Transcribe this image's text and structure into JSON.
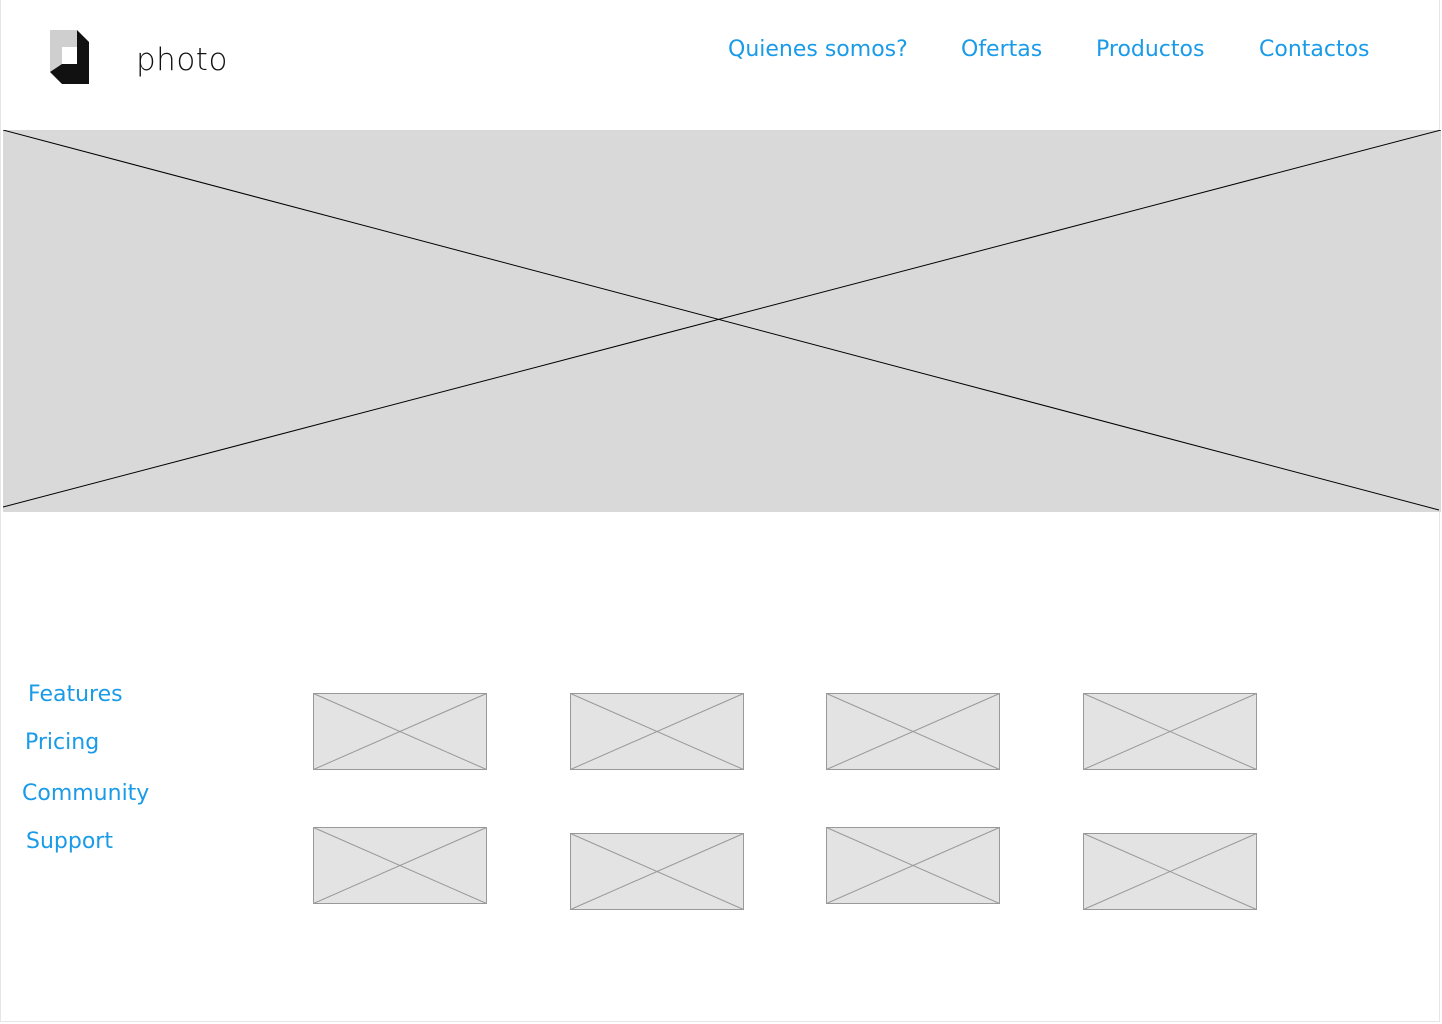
{
  "header": {
    "brand_name": "photo",
    "logo_icon": "photo-logo-icon",
    "nav": [
      {
        "label": "Quienes somos?"
      },
      {
        "label": "Ofertas"
      },
      {
        "label": "Productos"
      },
      {
        "label": "Contactos"
      }
    ]
  },
  "hero": {
    "icon": "image-placeholder-icon"
  },
  "sidebar": {
    "links": [
      {
        "label": "Features"
      },
      {
        "label": "Pricing"
      },
      {
        "label": "Community"
      },
      {
        "label": "Support"
      }
    ]
  },
  "gallery": {
    "thumb_icon": "image-placeholder-icon",
    "count": 8
  },
  "colors": {
    "link": "#1a9be8",
    "placeholder_fill": "#d9d9d9",
    "thumb_fill": "#e3e3e3",
    "thumb_stroke": "#999999",
    "brand_text": "#111111"
  }
}
